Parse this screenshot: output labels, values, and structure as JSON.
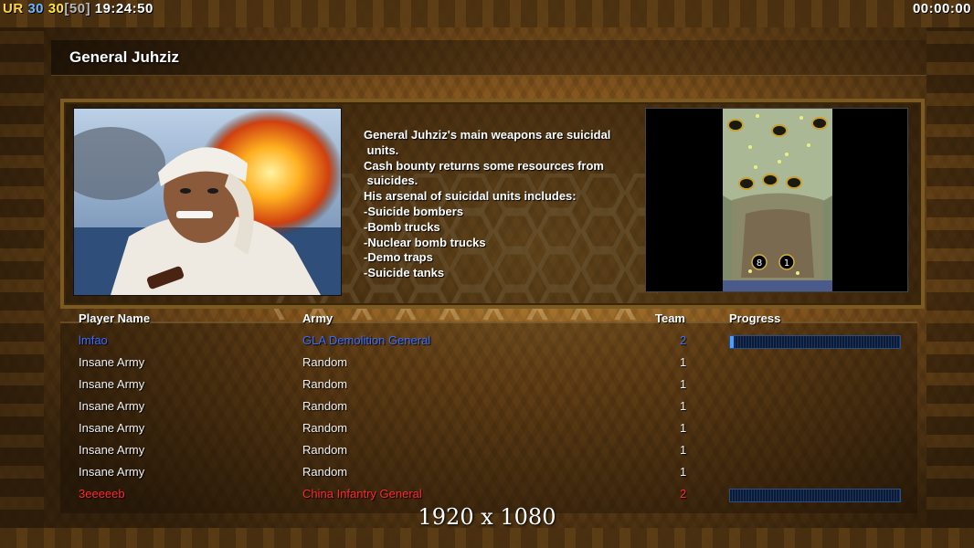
{
  "hud": {
    "ur": "UR",
    "val1": "30",
    "val2": "30",
    "bracket_val": "[50]",
    "clock": "19:24:50",
    "timer": "00:00:00"
  },
  "title": "General Juhziz",
  "description": "General Juhziz's main weapons are suicidal\n units.\nCash bounty returns some resources from\n suicides.\nHis arsenal of suicidal units includes:\n-Suicide bombers\n-Bomb trucks\n-Nuclear bomb trucks\n-Demo traps\n-Suicide tanks",
  "map": {
    "start_markers": [
      "8",
      "1"
    ]
  },
  "columns": {
    "player_name": "Player Name",
    "army": "Army",
    "team": "Team",
    "progress": "Progress"
  },
  "players": [
    {
      "name": "lmfao",
      "army": "GLA Demolition General",
      "team": "2",
      "color": "#3a6cff",
      "progress": 0.02,
      "has_progress": true
    },
    {
      "name": "Insane Army",
      "army": "Random",
      "team": "1",
      "color": "#f2f2f2",
      "has_progress": false
    },
    {
      "name": "Insane Army",
      "army": "Random",
      "team": "1",
      "color": "#f2f2f2",
      "has_progress": false
    },
    {
      "name": "Insane Army",
      "army": "Random",
      "team": "1",
      "color": "#f2f2f2",
      "has_progress": false
    },
    {
      "name": "Insane Army",
      "army": "Random",
      "team": "1",
      "color": "#f2f2f2",
      "has_progress": false
    },
    {
      "name": "Insane Army",
      "army": "Random",
      "team": "1",
      "color": "#f2f2f2",
      "has_progress": false
    },
    {
      "name": "Insane Army",
      "army": "Random",
      "team": "1",
      "color": "#f2f2f2",
      "has_progress": false
    },
    {
      "name": "3eeeeeb",
      "army": "China Infantry General",
      "team": "2",
      "color": "#ff2a2a",
      "progress": 0.0,
      "has_progress": true
    }
  ],
  "resolution": "1920 x 1080"
}
